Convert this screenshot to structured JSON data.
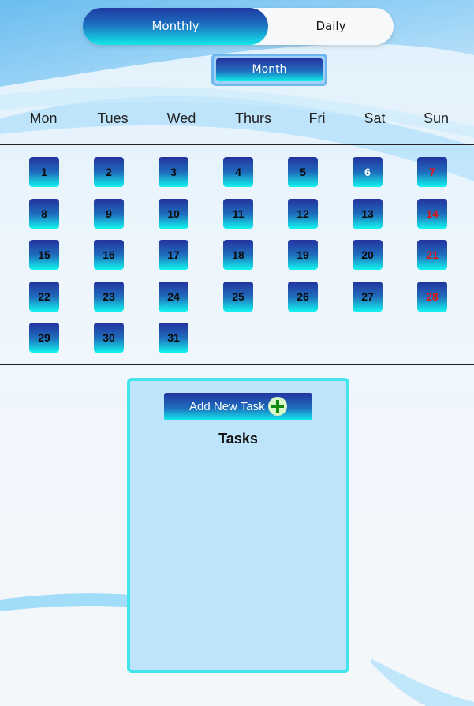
{
  "view_toggle": {
    "options": [
      {
        "label": "Monthly",
        "active": true
      },
      {
        "label": "Daily",
        "active": false
      }
    ]
  },
  "period_button": {
    "label": "Month"
  },
  "weekdays": [
    "Mon",
    "Tues",
    "Wed",
    "Thurs",
    "Fri",
    "Sat",
    "Sun"
  ],
  "calendar": {
    "weeks": [
      [
        "1",
        "2",
        "3",
        "4",
        "5",
        "6",
        "7"
      ],
      [
        "8",
        "9",
        "10",
        "11",
        "12",
        "13",
        "14"
      ],
      [
        "15",
        "16",
        "17",
        "18",
        "19",
        "20",
        "21"
      ],
      [
        "22",
        "23",
        "24",
        "25",
        "26",
        "27",
        "28"
      ],
      [
        "29",
        "30",
        "31"
      ]
    ],
    "highlighted_day": "6",
    "weekend_color": "#e01515"
  },
  "tasks": {
    "add_button_label": "Add New Task",
    "title": "Tasks",
    "items": []
  },
  "colors": {
    "accent_dark": "#23329e",
    "accent_light": "#13f4ef",
    "panel_bg": "#bde4fa",
    "panel_border": "#44e5ea"
  }
}
